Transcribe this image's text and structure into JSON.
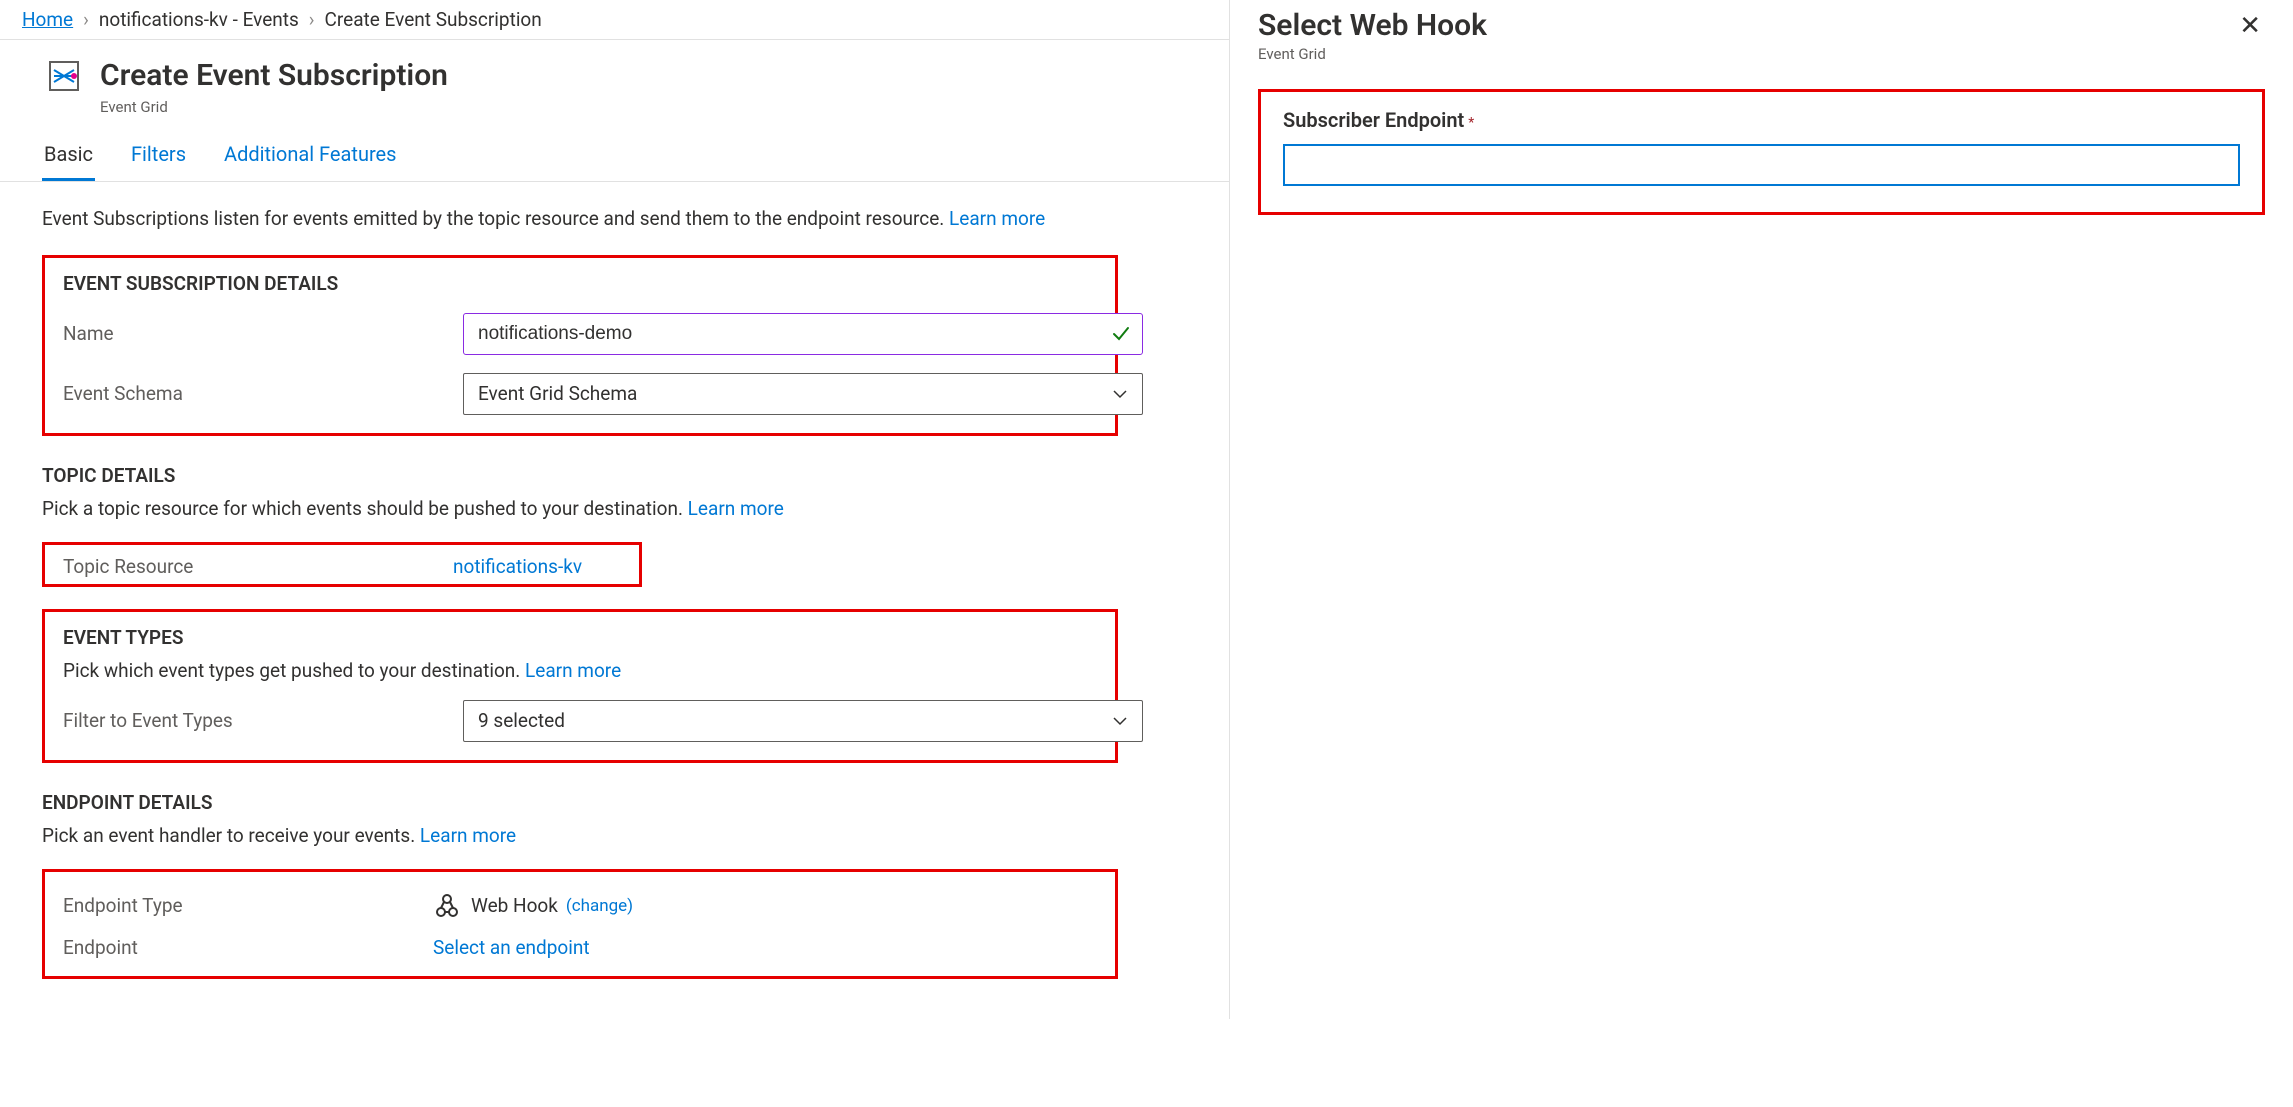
{
  "breadcrumb": {
    "home": "Home",
    "events": "notifications-kv - Events",
    "current": "Create Event Subscription"
  },
  "header": {
    "title": "Create Event Subscription",
    "subtitle": "Event Grid"
  },
  "tabs": [
    {
      "label": "Basic",
      "active": true
    },
    {
      "label": "Filters",
      "active": false
    },
    {
      "label": "Additional Features",
      "active": false
    }
  ],
  "lead": {
    "text": "Event Subscriptions listen for events emitted by the topic resource and send them to the endpoint resource. ",
    "learn_more": "Learn more"
  },
  "sections": {
    "subscription": {
      "title": "EVENT SUBSCRIPTION DETAILS",
      "name_label": "Name",
      "name_value": "notifications-demo",
      "schema_label": "Event Schema",
      "schema_value": "Event Grid Schema"
    },
    "topic": {
      "title": "TOPIC DETAILS",
      "desc": "Pick a topic resource for which events should be pushed to your destination. ",
      "learn_more": "Learn more",
      "resource_label": "Topic Resource",
      "resource_value": "notifications-kv"
    },
    "event_types": {
      "title": "EVENT TYPES",
      "desc": "Pick which event types get pushed to your destination. ",
      "learn_more": "Learn more",
      "filter_label": "Filter to Event Types",
      "filter_value": "9 selected"
    },
    "endpoint": {
      "title": "ENDPOINT DETAILS",
      "desc": "Pick an event handler to receive your events. ",
      "learn_more": "Learn more",
      "type_label": "Endpoint Type",
      "type_value": "Web Hook",
      "change": "(change)",
      "endpoint_label": "Endpoint",
      "endpoint_value": "Select an endpoint"
    }
  },
  "right": {
    "title": "Select Web Hook",
    "subtitle": "Event Grid",
    "field_label": "Subscriber Endpoint",
    "required": "*",
    "value": ""
  }
}
